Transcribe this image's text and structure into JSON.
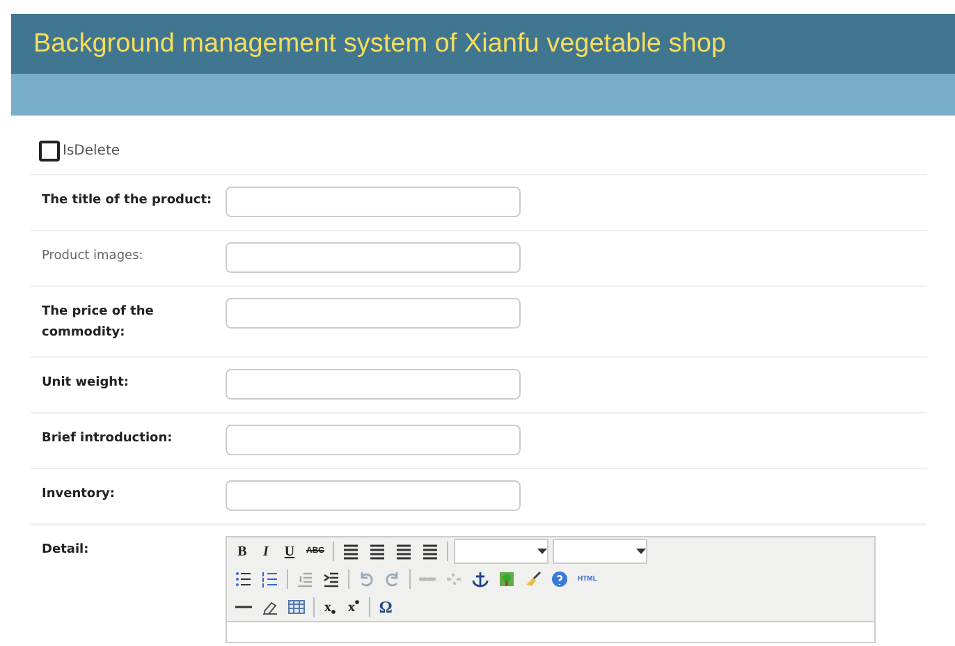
{
  "header": {
    "title": "Background management system of Xianfu vegetable shop"
  },
  "checkbox": {
    "label": "IsDelete",
    "checked": false
  },
  "fields": [
    {
      "label": "The title of the product:",
      "required": true,
      "kind": "input"
    },
    {
      "label": "Product images:",
      "required": false,
      "kind": "input"
    },
    {
      "label": "The price of the commodity:",
      "required": true,
      "kind": "input"
    },
    {
      "label": "Unit weight:",
      "required": true,
      "kind": "input"
    },
    {
      "label": "Brief introduction:",
      "required": true,
      "kind": "input"
    },
    {
      "label": "Inventory:",
      "required": true,
      "kind": "input"
    },
    {
      "label": "Detail:",
      "required": true,
      "kind": "editor"
    }
  ],
  "editor": {
    "toolbar": [
      [
        {
          "kind": "bold",
          "label": "B"
        },
        {
          "kind": "italic",
          "label": "I"
        },
        {
          "kind": "underline",
          "label": "U"
        },
        {
          "kind": "strike",
          "label": "ABC"
        },
        {
          "kind": "sep"
        },
        {
          "kind": "align"
        },
        {
          "kind": "align"
        },
        {
          "kind": "align"
        },
        {
          "kind": "align"
        },
        {
          "kind": "sep"
        },
        {
          "kind": "select"
        },
        {
          "kind": "select"
        }
      ],
      [
        {
          "kind": "bullets"
        },
        {
          "kind": "numbers"
        },
        {
          "kind": "sep"
        },
        {
          "kind": "outdent"
        },
        {
          "kind": "indent"
        },
        {
          "kind": "sep"
        },
        {
          "kind": "undo"
        },
        {
          "kind": "redo"
        },
        {
          "kind": "sep"
        },
        {
          "kind": "link"
        },
        {
          "kind": "unlink"
        },
        {
          "kind": "anchor"
        },
        {
          "kind": "image"
        },
        {
          "kind": "cleanup"
        },
        {
          "kind": "help"
        },
        {
          "kind": "html",
          "label": "HTML"
        }
      ],
      [
        {
          "kind": "rule"
        },
        {
          "kind": "eraser"
        },
        {
          "kind": "table"
        },
        {
          "kind": "sep"
        },
        {
          "kind": "sub",
          "label": "x"
        },
        {
          "kind": "sup",
          "label": "x"
        },
        {
          "kind": "sep"
        },
        {
          "kind": "symbol",
          "label": "Ω"
        }
      ]
    ]
  }
}
